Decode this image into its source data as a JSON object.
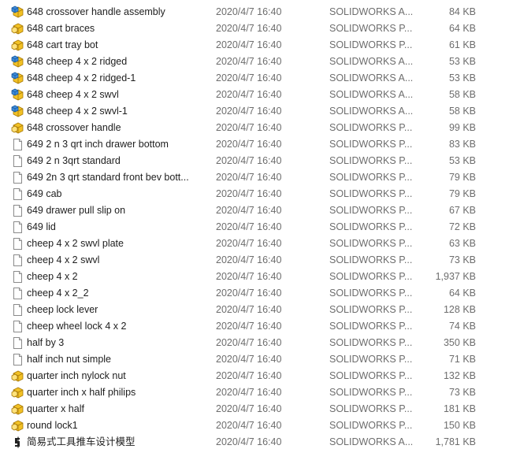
{
  "files": [
    {
      "name": "648  crossover handle assembly",
      "date": "2020/4/7 16:40",
      "type": "SOLIDWORKS A...",
      "size": "84 KB",
      "icon": "solidworks-assembly-icon"
    },
    {
      "name": "648 cart braces",
      "date": "2020/4/7 16:40",
      "type": "SOLIDWORKS P...",
      "size": "64 KB",
      "icon": "solidworks-part-icon"
    },
    {
      "name": "648 cart tray bot",
      "date": "2020/4/7 16:40",
      "type": "SOLIDWORKS P...",
      "size": "61 KB",
      "icon": "solidworks-part-icon"
    },
    {
      "name": "648 cheep 4 x 2 ridged",
      "date": "2020/4/7 16:40",
      "type": "SOLIDWORKS A...",
      "size": "53 KB",
      "icon": "solidworks-assembly-icon"
    },
    {
      "name": "648 cheep 4 x 2 ridged-1",
      "date": "2020/4/7 16:40",
      "type": "SOLIDWORKS A...",
      "size": "53 KB",
      "icon": "solidworks-assembly-icon"
    },
    {
      "name": "648 cheep 4 x 2 swvl",
      "date": "2020/4/7 16:40",
      "type": "SOLIDWORKS A...",
      "size": "58 KB",
      "icon": "solidworks-assembly-icon"
    },
    {
      "name": "648 cheep 4 x 2 swvl-1",
      "date": "2020/4/7 16:40",
      "type": "SOLIDWORKS A...",
      "size": "58 KB",
      "icon": "solidworks-assembly-icon"
    },
    {
      "name": "648 crossover handle",
      "date": "2020/4/7 16:40",
      "type": "SOLIDWORKS P...",
      "size": "99 KB",
      "icon": "solidworks-part-icon"
    },
    {
      "name": "649 2 n 3 qrt inch drawer bottom",
      "date": "2020/4/7 16:40",
      "type": "SOLIDWORKS P...",
      "size": "83 KB",
      "icon": "blank-file-icon"
    },
    {
      "name": "649 2 n 3qrt standard",
      "date": "2020/4/7 16:40",
      "type": "SOLIDWORKS P...",
      "size": "53 KB",
      "icon": "blank-file-icon"
    },
    {
      "name": "649 2n 3 qrt standard front bev bott...",
      "date": "2020/4/7 16:40",
      "type": "SOLIDWORKS P...",
      "size": "79 KB",
      "icon": "blank-file-icon"
    },
    {
      "name": "649 cab",
      "date": "2020/4/7 16:40",
      "type": "SOLIDWORKS P...",
      "size": "79 KB",
      "icon": "blank-file-icon"
    },
    {
      "name": "649 drawer pull slip on",
      "date": "2020/4/7 16:40",
      "type": "SOLIDWORKS P...",
      "size": "67 KB",
      "icon": "blank-file-icon"
    },
    {
      "name": "649 lid",
      "date": "2020/4/7 16:40",
      "type": "SOLIDWORKS P...",
      "size": "72 KB",
      "icon": "blank-file-icon"
    },
    {
      "name": "cheep 4 x 2 swvl plate",
      "date": "2020/4/7 16:40",
      "type": "SOLIDWORKS P...",
      "size": "63 KB",
      "icon": "blank-file-icon"
    },
    {
      "name": "cheep 4 x 2 swvl",
      "date": "2020/4/7 16:40",
      "type": "SOLIDWORKS P...",
      "size": "73 KB",
      "icon": "blank-file-icon"
    },
    {
      "name": "cheep 4 x 2",
      "date": "2020/4/7 16:40",
      "type": "SOLIDWORKS P...",
      "size": "1,937 KB",
      "icon": "blank-file-icon"
    },
    {
      "name": "cheep 4 x 2_2",
      "date": "2020/4/7 16:40",
      "type": "SOLIDWORKS P...",
      "size": "64 KB",
      "icon": "blank-file-icon"
    },
    {
      "name": "cheep lock lever",
      "date": "2020/4/7 16:40",
      "type": "SOLIDWORKS P...",
      "size": "128 KB",
      "icon": "blank-file-icon"
    },
    {
      "name": "cheep wheel lock 4 x 2",
      "date": "2020/4/7 16:40",
      "type": "SOLIDWORKS P...",
      "size": "74 KB",
      "icon": "blank-file-icon"
    },
    {
      "name": "half by 3",
      "date": "2020/4/7 16:40",
      "type": "SOLIDWORKS P...",
      "size": "350 KB",
      "icon": "blank-file-icon"
    },
    {
      "name": "half inch nut simple",
      "date": "2020/4/7 16:40",
      "type": "SOLIDWORKS P...",
      "size": "71 KB",
      "icon": "blank-file-icon"
    },
    {
      "name": "quarter inch nylock nut",
      "date": "2020/4/7 16:40",
      "type": "SOLIDWORKS P...",
      "size": "132 KB",
      "icon": "solidworks-part-icon"
    },
    {
      "name": "quarter inch x half philips",
      "date": "2020/4/7 16:40",
      "type": "SOLIDWORKS P...",
      "size": "73 KB",
      "icon": "solidworks-part-icon"
    },
    {
      "name": "quarter x half",
      "date": "2020/4/7 16:40",
      "type": "SOLIDWORKS P...",
      "size": "181 KB",
      "icon": "solidworks-part-icon"
    },
    {
      "name": "round lock1",
      "date": "2020/4/7 16:40",
      "type": "SOLIDWORKS P...",
      "size": "150 KB",
      "icon": "solidworks-part-icon"
    },
    {
      "name": "简易式工具推车设计模型",
      "date": "2020/4/7 16:40",
      "type": "SOLIDWORKS A...",
      "size": "1,781 KB",
      "icon": "solidworks-shortcut-icon"
    }
  ],
  "colors": {
    "name_text": "#1e1e1e",
    "meta_text": "#6d6d6d",
    "part_yellow": "#f0c020",
    "part_blue": "#2f7fd0"
  }
}
